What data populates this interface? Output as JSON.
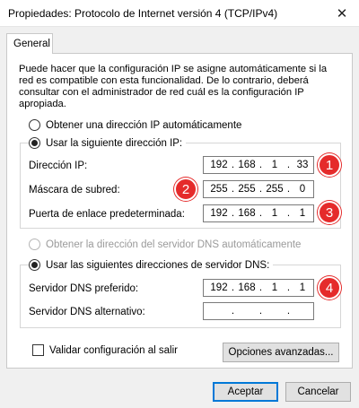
{
  "window": {
    "title": "Propiedades: Protocolo de Internet versión 4 (TCP/IPv4)",
    "close_glyph": "✕"
  },
  "tabs": [
    {
      "label": "General"
    }
  ],
  "description_lines": [
    "Puede hacer que la configuración IP se asigne automáticamente si la",
    "red es compatible con esta funcionalidad. De lo contrario, deberá",
    "consultar con el administrador de red cuál es la configuración IP",
    "apropiada."
  ],
  "ip_mode": {
    "auto_label": "Obtener una dirección IP automáticamente",
    "manual_label": "Usar la siguiente dirección IP:",
    "selected": "manual"
  },
  "ip_fields": [
    {
      "label": "Dirección IP:",
      "octets": [
        "192",
        "168",
        "1",
        "33"
      ],
      "badge": "1"
    },
    {
      "label": "Máscara de subred:",
      "octets": [
        "255",
        "255",
        "255",
        "0"
      ],
      "badge": "2"
    },
    {
      "label": "Puerta de enlace predeterminada:",
      "octets": [
        "192",
        "168",
        "1",
        "1"
      ],
      "badge": "3"
    }
  ],
  "dns_mode": {
    "auto_label": "Obtener la dirección del servidor DNS automáticamente",
    "manual_label": "Usar las siguientes direcciones de servidor DNS:",
    "selected": "manual"
  },
  "dns_fields": [
    {
      "label": "Servidor DNS preferido:",
      "octets": [
        "192",
        "168",
        "1",
        "1"
      ],
      "badge": "4"
    },
    {
      "label": "Servidor DNS alternativo:",
      "octets": [
        "",
        "",
        "",
        ""
      ]
    }
  ],
  "validate": {
    "label": "Validar configuración al salir",
    "checked": false
  },
  "buttons": {
    "advanced": "Opciones avanzadas...",
    "accept": "Aceptar",
    "cancel": "Cancelar"
  },
  "colors": {
    "badge": "#e52b2b",
    "default_button_border": "#0078d7"
  }
}
